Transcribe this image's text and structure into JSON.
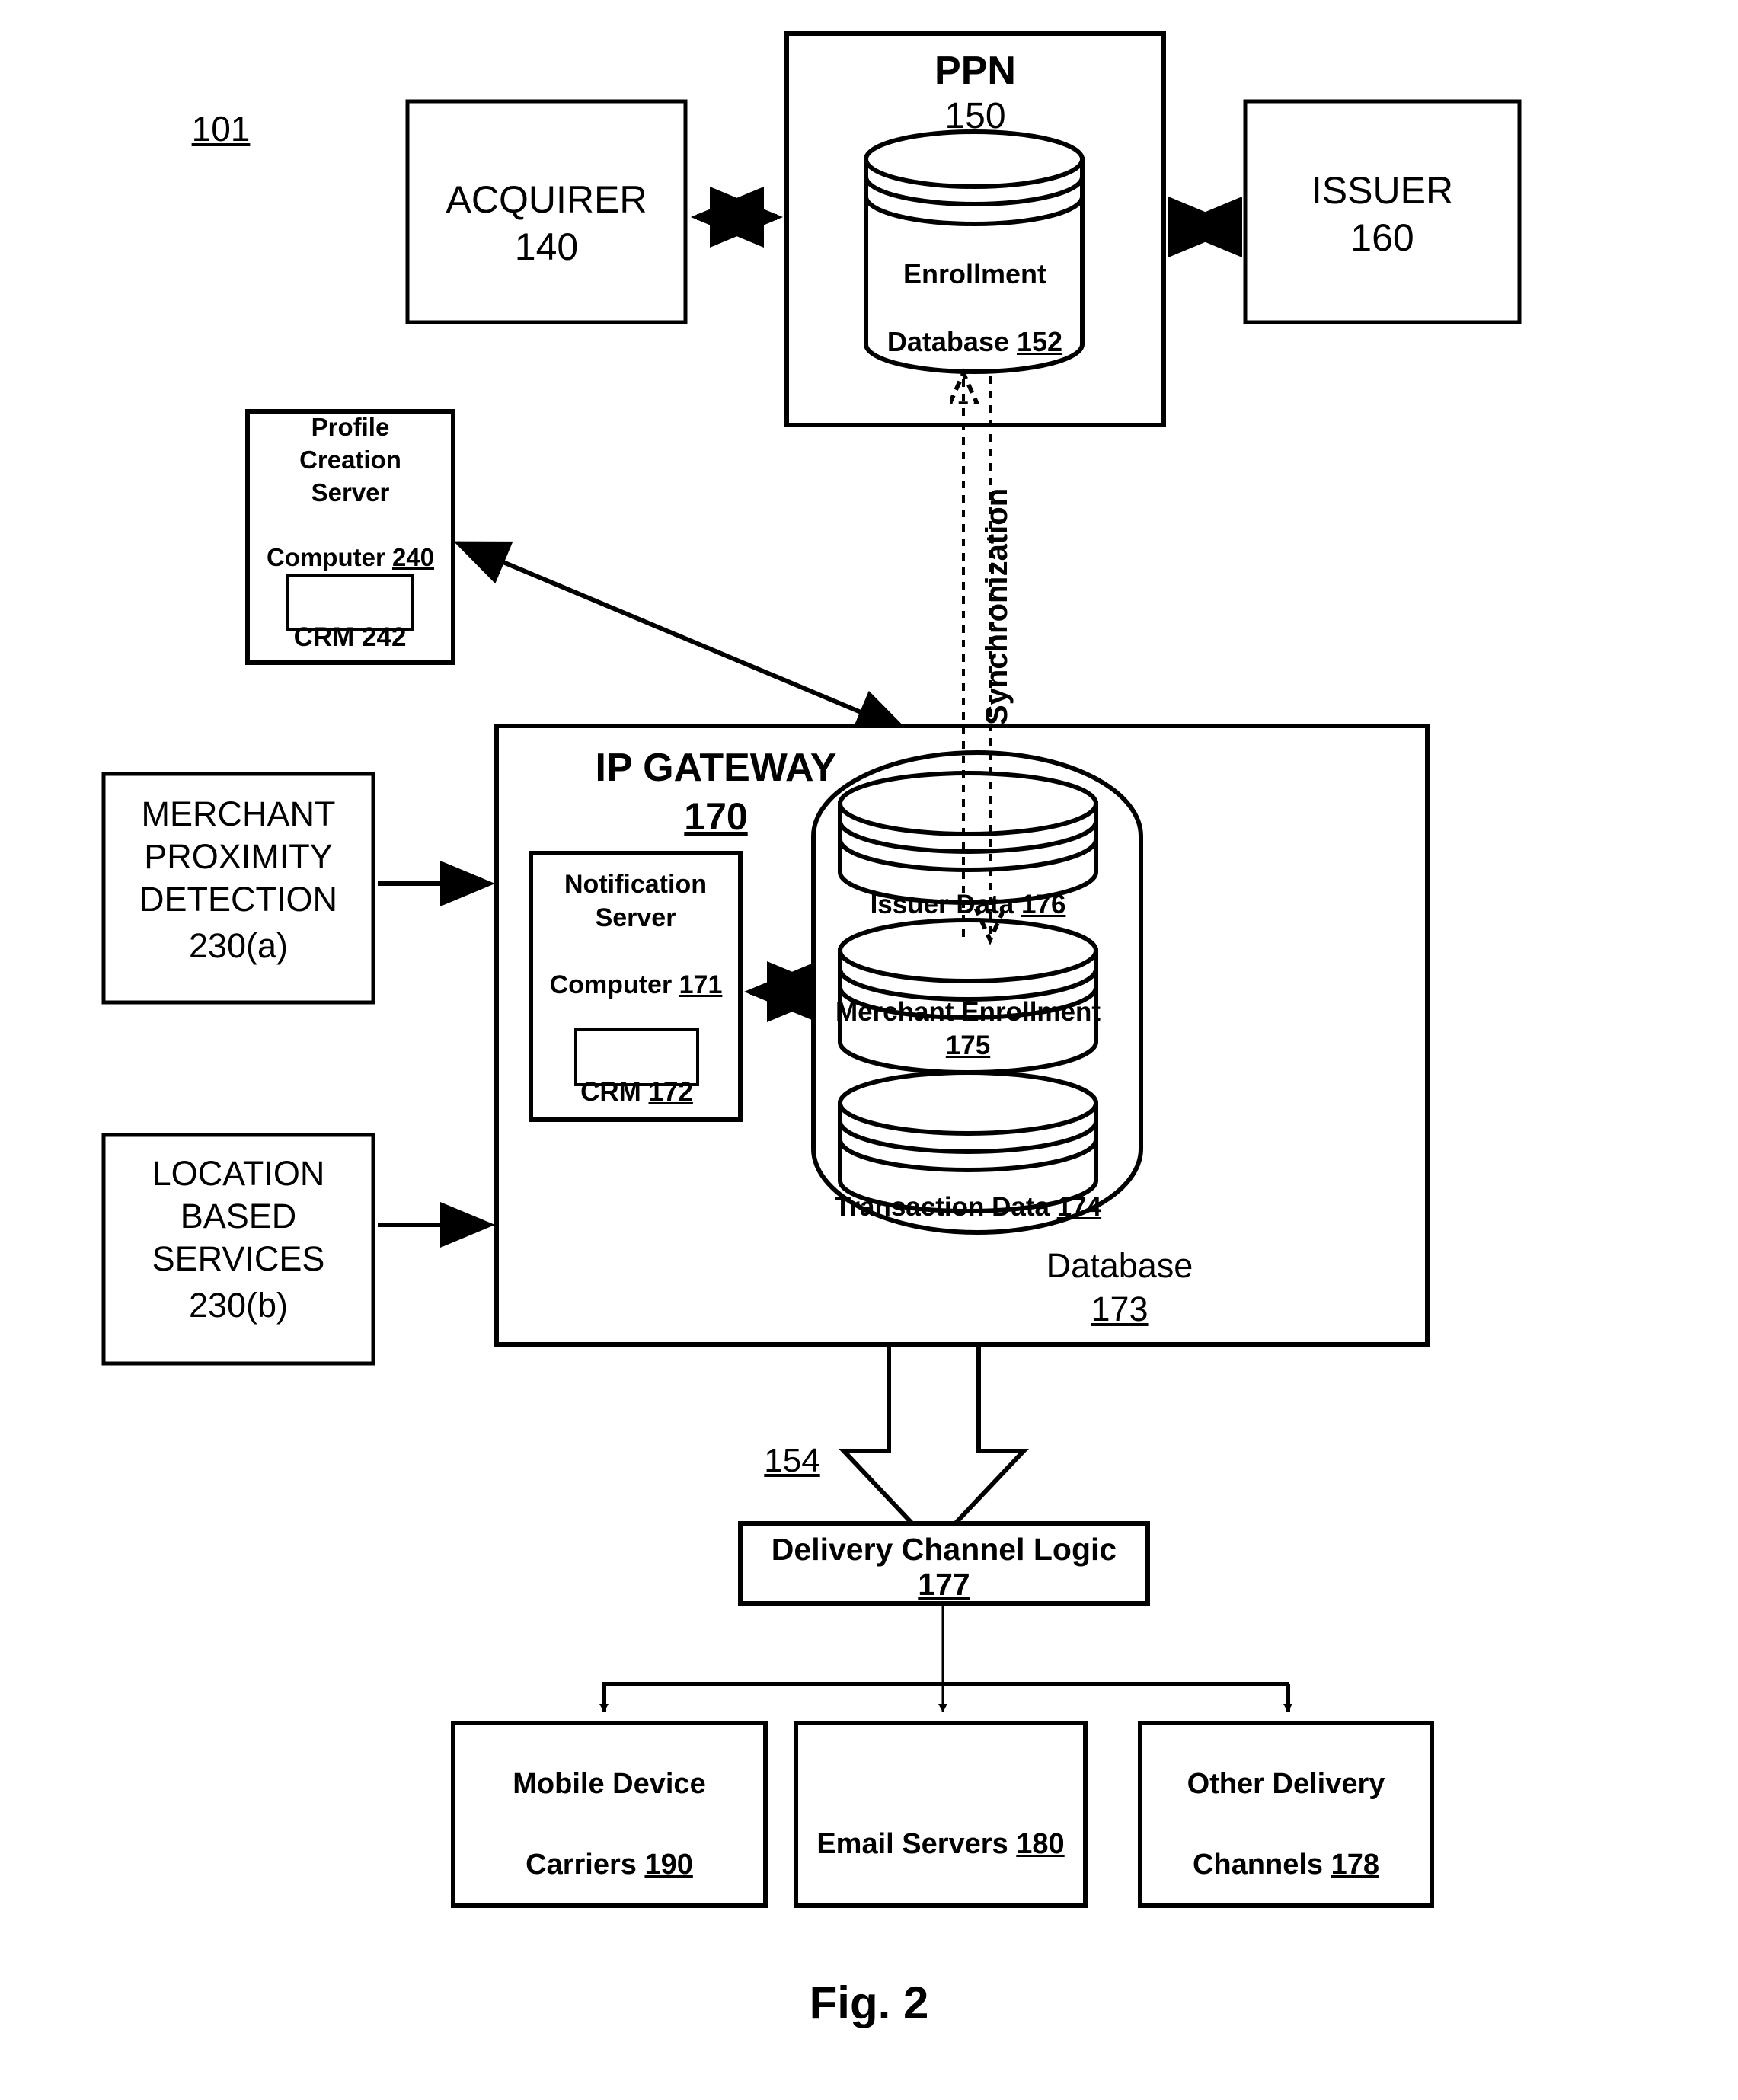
{
  "figure": {
    "caption": "Fig. 2",
    "system_ref": "101"
  },
  "nodes": {
    "acquirer": {
      "title": "ACQUIRER",
      "ref": "140"
    },
    "ppn": {
      "title": "PPN",
      "ref": "150"
    },
    "enrollment_database": {
      "line1": "Enrollment",
      "line2": "Database",
      "ref": "152"
    },
    "issuer": {
      "title": "ISSUER",
      "ref": "160"
    },
    "profile_creation_server": {
      "line1": "Profile",
      "line2": "Creation",
      "line3": "Server",
      "line4": "Computer",
      "ref": "240"
    },
    "profile_crm": {
      "label": "CRM",
      "ref": "242"
    },
    "merchant_proximity_detection": {
      "line1": "MERCHANT",
      "line2": "PROXIMITY",
      "line3": "DETECTION",
      "ref": "230(a)"
    },
    "location_based_services": {
      "line1": "LOCATION",
      "line2": "BASED",
      "line3": "SERVICES",
      "ref": "230(b)"
    },
    "ip_gateway": {
      "title": "IP GATEWAY",
      "ref": "170"
    },
    "notification_server": {
      "line1": "Notification",
      "line2": "Server",
      "line3": "Computer",
      "ref": "171"
    },
    "notification_crm": {
      "label": "CRM",
      "ref": "172"
    },
    "issuer_data": {
      "label": "Issuer Data",
      "ref": "176"
    },
    "merchant_enrollment": {
      "label": "Merchant Enrollment",
      "ref": "175"
    },
    "transaction_data": {
      "label": "Transaction Data",
      "ref": "174"
    },
    "database": {
      "label": "Database",
      "ref": "173"
    },
    "delivery_channel_logic": {
      "label": "Delivery Channel Logic",
      "ref": "177"
    },
    "mobile_device_carriers": {
      "line1": "Mobile Device",
      "line2": "Carriers",
      "ref": "190"
    },
    "email_servers": {
      "label": "Email Servers",
      "ref": "180"
    },
    "other_delivery_channels": {
      "line1": "Other Delivery",
      "line2": "Channels",
      "ref": "178"
    }
  },
  "connectors": {
    "sync_label": "Synchronization",
    "big_arrow_ref": "154"
  },
  "colors": {
    "stroke": "#000000",
    "background": "#ffffff"
  }
}
